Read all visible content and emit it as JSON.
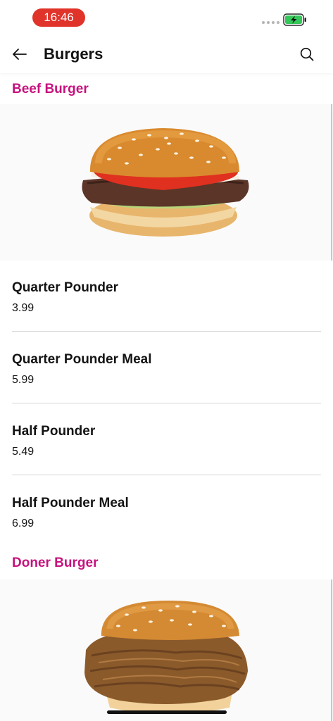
{
  "status_bar": {
    "time": "16:46",
    "time_pill_color": "#e0342b",
    "battery_color": "#34c759"
  },
  "header": {
    "title": "Burgers",
    "back_icon": "arrow-left-icon",
    "search_icon": "search-icon"
  },
  "sections": [
    {
      "title": "Beef Burger",
      "items": [
        {
          "name": "Quarter Pounder",
          "price": "3.99"
        },
        {
          "name": "Quarter Pounder Meal",
          "price": "5.99"
        },
        {
          "name": "Half Pounder",
          "price": "5.49"
        },
        {
          "name": "Half Pounder Meal",
          "price": "6.99"
        }
      ]
    },
    {
      "title": "Doner Burger",
      "items": []
    }
  ],
  "colors": {
    "section_title": "#c6127e",
    "text": "#141414",
    "divider": "#d6d6d6"
  }
}
